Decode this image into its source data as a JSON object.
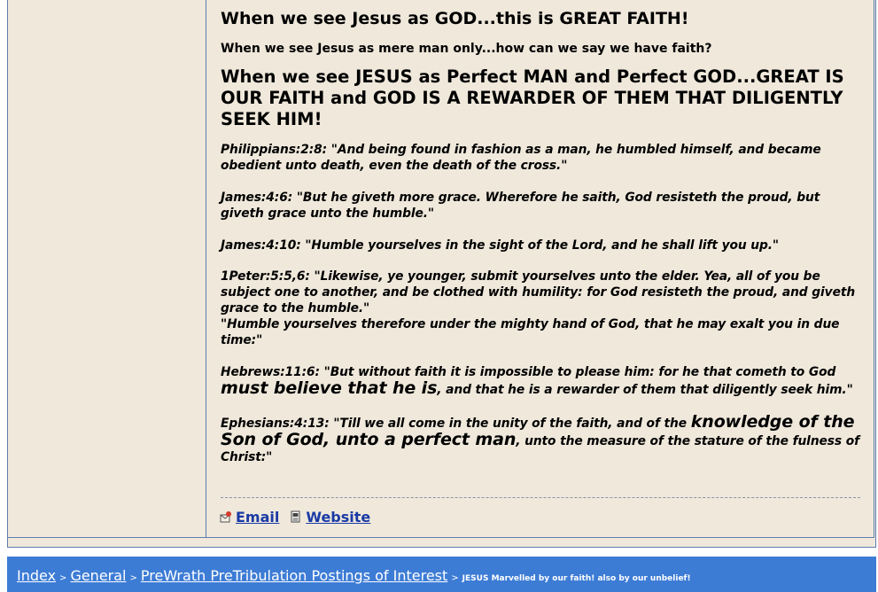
{
  "post": {
    "heading_faith": "When we see Jesus as GOD...this is GREAT FAITH!",
    "question": "When we see Jesus as mere man only...how can we say we have faith?",
    "heading_reward": "When we see JESUS as Perfect MAN and Perfect GOD...GREAT IS OUR FAITH and GOD IS A REWARDER OF THEM THAT DILIGENTLY SEEK HIM!",
    "verses": {
      "philippians": "Philippians:2:8: \"And being found in fashion as a man, he humbled himself, and became obedient unto death, even the death of the cross.\"",
      "james_4_6": "James:4:6: \"But he giveth more grace. Wherefore he saith, God resisteth the proud, but giveth grace unto the humble.\"",
      "james_4_10": "James:4:10: \"Humble yourselves in the sight of the Lord, and he shall lift you up.\"",
      "peter_1": "1Peter:5:5,6: \"Likewise, ye younger, submit yourselves unto the elder. Yea, all of you be subject one to another, and be clothed with humility: for God resisteth the proud, and giveth grace to the humble.\"",
      "peter_2": "\"Humble yourselves therefore under the mighty hand of God, that he may exalt you in due time:\"",
      "hebrews_pre": "Hebrews:11:6: \"But without faith it is impossible to please him: for he that cometh to God ",
      "hebrews_big": "must believe that he is",
      "hebrews_post": ", and that he is a rewarder of them that diligently seek him.\"",
      "ephesians_pre": "Ephesians:4:13: \"Till we all come in the unity of the faith, and of the ",
      "ephesians_big": "knowledge of the Son of God, unto a perfect man",
      "ephesians_post": ", unto the measure of the stature of the fulness of Christ:\""
    }
  },
  "actions": {
    "email_label": "Email",
    "website_label": "Website",
    "email_icon": "email-icon",
    "website_icon": "website-icon"
  },
  "breadcrumb": {
    "items": [
      "Index",
      "General",
      "PreWrath PreTribulation Postings of Interest"
    ],
    "separator": ">",
    "current": "JESUS Marvelled by our faith! also by our unbelief!"
  },
  "colors": {
    "post_background": "#efe8db",
    "border": "#5f7fae",
    "link": "#1a3aa6",
    "nav_background": "#3d7cd5"
  }
}
